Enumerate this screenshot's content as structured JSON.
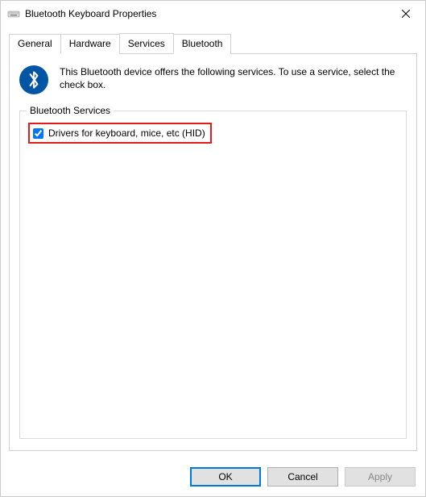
{
  "window": {
    "title": "Bluetooth Keyboard Properties"
  },
  "tabs": {
    "general": "General",
    "hardware": "Hardware",
    "services": "Services",
    "bluetooth": "Bluetooth",
    "active": "services"
  },
  "info": {
    "text": "This Bluetooth device offers the following services. To use a service, select the check box."
  },
  "group": {
    "legend": "Bluetooth Services",
    "service1": "Drivers for keyboard, mice, etc (HID)",
    "service1_checked": true
  },
  "buttons": {
    "ok": "OK",
    "cancel": "Cancel",
    "apply": "Apply"
  }
}
